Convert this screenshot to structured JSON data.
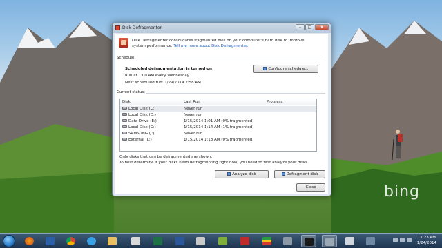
{
  "window": {
    "title": "Disk Defragmenter",
    "buttons": {
      "minimize": "–",
      "maximize": "□",
      "close": "x"
    }
  },
  "intro": {
    "text": "Disk Defragmenter consolidates fragmented files on your computer's hard disk to improve system performance.",
    "link": "Tell me more about Disk Defragmenter."
  },
  "schedule": {
    "section_label": "Schedule:",
    "status": "Scheduled defragmentation is turned on",
    "run_at": "Run at 1:00 AM every Wednesday",
    "next_run": "Next scheduled run: 1/29/2014 2:58 AM",
    "configure_button": "Configure schedule..."
  },
  "current_status": {
    "section_label": "Current status:",
    "columns": [
      "Disk",
      "Last Run",
      "Progress"
    ],
    "rows": [
      {
        "disk": "Local Disk (C:)",
        "last_run": "Never run",
        "progress": ""
      },
      {
        "disk": "Local Disk (D:)",
        "last_run": "Never run",
        "progress": ""
      },
      {
        "disk": "Data Drive (E:)",
        "last_run": "1/15/2014 1:01 AM (0% fragmented)",
        "progress": ""
      },
      {
        "disk": "Local Disc (G:)",
        "last_run": "1/15/2014 1:14 AM (1% fragmented)",
        "progress": ""
      },
      {
        "disk": "SAMSUNG (J:)",
        "last_run": "Never run",
        "progress": ""
      },
      {
        "disk": "External (L:)",
        "last_run": "1/15/2014 1:18 AM (0% fragmented)",
        "progress": ""
      }
    ]
  },
  "notes": {
    "line1": "Only disks that can be defragmented are shown.",
    "line2": "To best determine if your disks need defragmenting right now, you need to first analyze your disks."
  },
  "actions": {
    "analyze": "Analyze disk",
    "defragment": "Defragment disk",
    "close": "Close"
  },
  "desktop": {
    "brand": "bing"
  },
  "taskbar": {
    "clock_time": "11:23 AM",
    "clock_date": "1/24/2014",
    "items": [
      "firefox-icon",
      "network-icon",
      "chrome-icon",
      "ie-icon",
      "explorer-icon",
      "media-icon",
      "excel-icon",
      "word-icon",
      "pdf-icon",
      "archive-icon",
      "filezilla-icon",
      "flag-app-icon",
      "calculator-icon",
      "terminal-icon",
      "disk-defrag-icon",
      "tools-icon",
      "chart-icon"
    ]
  },
  "colors": {
    "accent": "#1a58b5",
    "taskbar": "#1e3550"
  }
}
